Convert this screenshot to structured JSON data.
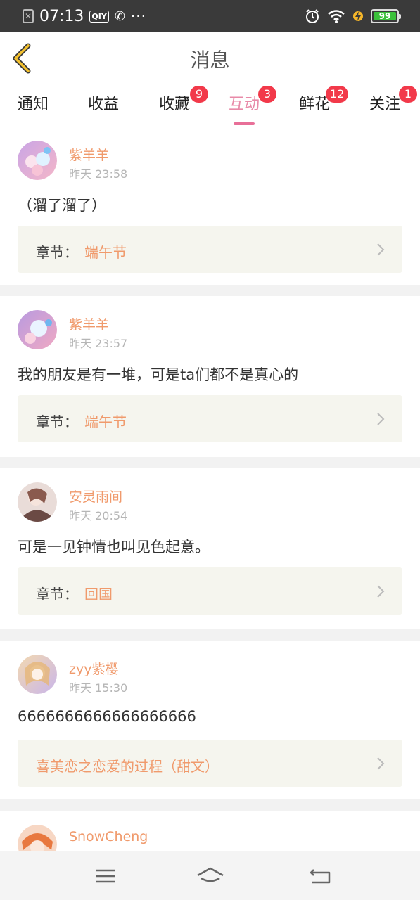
{
  "status_bar": {
    "time": "07:13",
    "battery": "99",
    "left_icons": [
      "close-box-icon",
      "iqiyi-icon",
      "wechat-icon",
      "more-dots-icon"
    ],
    "right_icons": [
      "alarm-icon",
      "wifi-icon",
      "charging-icon",
      "battery-icon"
    ]
  },
  "header": {
    "title": "消息",
    "back_icon": "back-chevron-icon"
  },
  "tabs": [
    {
      "label": "通知",
      "badge": "",
      "active": false
    },
    {
      "label": "收益",
      "badge": "",
      "active": false
    },
    {
      "label": "收藏",
      "badge": "9",
      "active": false
    },
    {
      "label": "互动",
      "badge": "3",
      "active": true
    },
    {
      "label": "鲜花",
      "badge": "12",
      "active": false
    },
    {
      "label": "关注",
      "badge": "1",
      "active": false
    }
  ],
  "messages": [
    {
      "user": "紫羊羊",
      "time": "昨天 23:58",
      "content": "（溜了溜了）",
      "chapter_prefix": "章节：",
      "chapter_title": "端午节"
    },
    {
      "user": "紫羊羊",
      "time": "昨天 23:57",
      "content": "我的朋友是有一堆，可是ta们都不是真心的",
      "chapter_prefix": "章节：",
      "chapter_title": "端午节"
    },
    {
      "user": "安灵雨间",
      "time": "昨天 20:54",
      "content": "可是一见钟情也叫见色起意。",
      "chapter_prefix": "章节：",
      "chapter_title": "回国"
    },
    {
      "user": "zyy紫樱",
      "time": "昨天 15:30",
      "content": "6666666666666666666",
      "chapter_prefix": "",
      "chapter_title": "喜美恋之恋爱的过程（甜文）"
    },
    {
      "user": "SnowCheng",
      "time": "",
      "content": "",
      "chapter_prefix": "",
      "chapter_title": ""
    }
  ],
  "nav_bar": {
    "icons": [
      "menu-icon",
      "home-icon",
      "return-icon"
    ]
  },
  "colors": {
    "accent": "#e88aa8",
    "username": "#f09a6c",
    "badge": "#f2394a",
    "status_bar": "#3a3a3a"
  }
}
